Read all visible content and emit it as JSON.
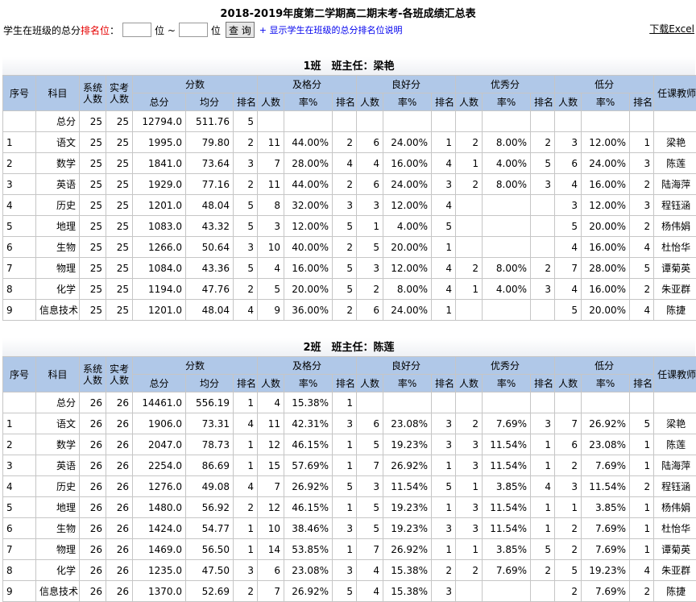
{
  "page_title": "2018-2019年度第二学期高二期末考-各班成绩汇总表",
  "filter": {
    "label_prefix": "学生在班级的总分",
    "label_highlight": "排名位",
    "label_suffix": "：",
    "from_value": "",
    "separator_1": "位 ~",
    "to_value": "",
    "separator_2": "位",
    "query_button": "查 询",
    "help_link": "+ 显示学生在班级的总分排名位说明"
  },
  "download_link": "下载Excel",
  "headers": {
    "seq": "序号",
    "subject": "科目",
    "sys_count_1": "系统",
    "sys_count_2": "人数",
    "act_count_1": "实考",
    "act_count_2": "人数",
    "score": "分数",
    "pass": "及格分",
    "good": "良好分",
    "excellent": "优秀分",
    "low": "低分",
    "teacher": "任课教师",
    "total": "总分",
    "avg": "均分",
    "rank": "排名",
    "count": "人数",
    "rate": "率%"
  },
  "classes": [
    {
      "title": "1班　班主任：梁艳",
      "rows": [
        {
          "seq": "",
          "subject": "总分",
          "sys": "25",
          "act": "25",
          "total": "12794.0",
          "avg": "511.76",
          "rank": "5",
          "pass_n": "",
          "pass_rate": "",
          "pass_rank": "",
          "good_n": "",
          "good_rate": "",
          "good_rank": "",
          "exc_n": "",
          "exc_rate": "",
          "exc_rank": "",
          "low_n": "",
          "low_rate": "",
          "low_rank": "",
          "teacher": ""
        },
        {
          "seq": "1",
          "subject": "语文",
          "sys": "25",
          "act": "25",
          "total": "1995.0",
          "avg": "79.80",
          "rank": "2",
          "pass_n": "11",
          "pass_rate": "44.00%",
          "pass_rank": "2",
          "good_n": "6",
          "good_rate": "24.00%",
          "good_rank": "1",
          "exc_n": "2",
          "exc_rate": "8.00%",
          "exc_rank": "2",
          "low_n": "3",
          "low_rate": "12.00%",
          "low_rank": "1",
          "teacher": "梁艳"
        },
        {
          "seq": "2",
          "subject": "数学",
          "sys": "25",
          "act": "25",
          "total": "1841.0",
          "avg": "73.64",
          "rank": "3",
          "pass_n": "7",
          "pass_rate": "28.00%",
          "pass_rank": "4",
          "good_n": "4",
          "good_rate": "16.00%",
          "good_rank": "4",
          "exc_n": "1",
          "exc_rate": "4.00%",
          "exc_rank": "5",
          "low_n": "6",
          "low_rate": "24.00%",
          "low_rank": "3",
          "teacher": "陈莲"
        },
        {
          "seq": "3",
          "subject": "英语",
          "sys": "25",
          "act": "25",
          "total": "1929.0",
          "avg": "77.16",
          "rank": "2",
          "pass_n": "11",
          "pass_rate": "44.00%",
          "pass_rank": "2",
          "good_n": "6",
          "good_rate": "24.00%",
          "good_rank": "3",
          "exc_n": "2",
          "exc_rate": "8.00%",
          "exc_rank": "3",
          "low_n": "4",
          "low_rate": "16.00%",
          "low_rank": "2",
          "teacher": "陆海萍"
        },
        {
          "seq": "4",
          "subject": "历史",
          "sys": "25",
          "act": "25",
          "total": "1201.0",
          "avg": "48.04",
          "rank": "5",
          "pass_n": "8",
          "pass_rate": "32.00%",
          "pass_rank": "3",
          "good_n": "3",
          "good_rate": "12.00%",
          "good_rank": "4",
          "exc_n": "",
          "exc_rate": "",
          "exc_rank": "",
          "low_n": "3",
          "low_rate": "12.00%",
          "low_rank": "3",
          "teacher": "程钰涵"
        },
        {
          "seq": "5",
          "subject": "地理",
          "sys": "25",
          "act": "25",
          "total": "1083.0",
          "avg": "43.32",
          "rank": "5",
          "pass_n": "3",
          "pass_rate": "12.00%",
          "pass_rank": "5",
          "good_n": "1",
          "good_rate": "4.00%",
          "good_rank": "5",
          "exc_n": "",
          "exc_rate": "",
          "exc_rank": "",
          "low_n": "5",
          "low_rate": "20.00%",
          "low_rank": "2",
          "teacher": "杨伟娟"
        },
        {
          "seq": "6",
          "subject": "生物",
          "sys": "25",
          "act": "25",
          "total": "1266.0",
          "avg": "50.64",
          "rank": "3",
          "pass_n": "10",
          "pass_rate": "40.00%",
          "pass_rank": "2",
          "good_n": "5",
          "good_rate": "20.00%",
          "good_rank": "1",
          "exc_n": "",
          "exc_rate": "",
          "exc_rank": "",
          "low_n": "4",
          "low_rate": "16.00%",
          "low_rank": "4",
          "teacher": "杜怡华"
        },
        {
          "seq": "7",
          "subject": "物理",
          "sys": "25",
          "act": "25",
          "total": "1084.0",
          "avg": "43.36",
          "rank": "5",
          "pass_n": "4",
          "pass_rate": "16.00%",
          "pass_rank": "5",
          "good_n": "3",
          "good_rate": "12.00%",
          "good_rank": "4",
          "exc_n": "2",
          "exc_rate": "8.00%",
          "exc_rank": "2",
          "low_n": "7",
          "low_rate": "28.00%",
          "low_rank": "5",
          "teacher": "谭菊英"
        },
        {
          "seq": "8",
          "subject": "化学",
          "sys": "25",
          "act": "25",
          "total": "1194.0",
          "avg": "47.76",
          "rank": "2",
          "pass_n": "5",
          "pass_rate": "20.00%",
          "pass_rank": "5",
          "good_n": "2",
          "good_rate": "8.00%",
          "good_rank": "4",
          "exc_n": "1",
          "exc_rate": "4.00%",
          "exc_rank": "3",
          "low_n": "4",
          "low_rate": "16.00%",
          "low_rank": "2",
          "teacher": "朱亚群"
        },
        {
          "seq": "9",
          "subject": "信息技术",
          "sys": "25",
          "act": "25",
          "total": "1201.0",
          "avg": "48.04",
          "rank": "4",
          "pass_n": "9",
          "pass_rate": "36.00%",
          "pass_rank": "2",
          "good_n": "6",
          "good_rate": "24.00%",
          "good_rank": "1",
          "exc_n": "",
          "exc_rate": "",
          "exc_rank": "",
          "low_n": "5",
          "low_rate": "20.00%",
          "low_rank": "4",
          "teacher": "陈捷"
        }
      ]
    },
    {
      "title": "2班　班主任：陈莲",
      "rows": [
        {
          "seq": "",
          "subject": "总分",
          "sys": "26",
          "act": "26",
          "total": "14461.0",
          "avg": "556.19",
          "rank": "1",
          "pass_n": "4",
          "pass_rate": "15.38%",
          "pass_rank": "1",
          "good_n": "",
          "good_rate": "",
          "good_rank": "",
          "exc_n": "",
          "exc_rate": "",
          "exc_rank": "",
          "low_n": "",
          "low_rate": "",
          "low_rank": "",
          "teacher": ""
        },
        {
          "seq": "1",
          "subject": "语文",
          "sys": "26",
          "act": "26",
          "total": "1906.0",
          "avg": "73.31",
          "rank": "4",
          "pass_n": "11",
          "pass_rate": "42.31%",
          "pass_rank": "3",
          "good_n": "6",
          "good_rate": "23.08%",
          "good_rank": "3",
          "exc_n": "2",
          "exc_rate": "7.69%",
          "exc_rank": "3",
          "low_n": "7",
          "low_rate": "26.92%",
          "low_rank": "5",
          "teacher": "梁艳"
        },
        {
          "seq": "2",
          "subject": "数学",
          "sys": "26",
          "act": "26",
          "total": "2047.0",
          "avg": "78.73",
          "rank": "1",
          "pass_n": "12",
          "pass_rate": "46.15%",
          "pass_rank": "1",
          "good_n": "5",
          "good_rate": "19.23%",
          "good_rank": "3",
          "exc_n": "3",
          "exc_rate": "11.54%",
          "exc_rank": "1",
          "low_n": "6",
          "low_rate": "23.08%",
          "low_rank": "1",
          "teacher": "陈莲"
        },
        {
          "seq": "3",
          "subject": "英语",
          "sys": "26",
          "act": "26",
          "total": "2254.0",
          "avg": "86.69",
          "rank": "1",
          "pass_n": "15",
          "pass_rate": "57.69%",
          "pass_rank": "1",
          "good_n": "7",
          "good_rate": "26.92%",
          "good_rank": "1",
          "exc_n": "3",
          "exc_rate": "11.54%",
          "exc_rank": "1",
          "low_n": "2",
          "low_rate": "7.69%",
          "low_rank": "1",
          "teacher": "陆海萍"
        },
        {
          "seq": "4",
          "subject": "历史",
          "sys": "26",
          "act": "26",
          "total": "1276.0",
          "avg": "49.08",
          "rank": "4",
          "pass_n": "7",
          "pass_rate": "26.92%",
          "pass_rank": "5",
          "good_n": "3",
          "good_rate": "11.54%",
          "good_rank": "5",
          "exc_n": "1",
          "exc_rate": "3.85%",
          "exc_rank": "4",
          "low_n": "3",
          "low_rate": "11.54%",
          "low_rank": "2",
          "teacher": "程钰涵"
        },
        {
          "seq": "5",
          "subject": "地理",
          "sys": "26",
          "act": "26",
          "total": "1480.0",
          "avg": "56.92",
          "rank": "2",
          "pass_n": "12",
          "pass_rate": "46.15%",
          "pass_rank": "1",
          "good_n": "5",
          "good_rate": "19.23%",
          "good_rank": "1",
          "exc_n": "3",
          "exc_rate": "11.54%",
          "exc_rank": "1",
          "low_n": "1",
          "low_rate": "3.85%",
          "low_rank": "1",
          "teacher": "杨伟娟"
        },
        {
          "seq": "6",
          "subject": "生物",
          "sys": "26",
          "act": "26",
          "total": "1424.0",
          "avg": "54.77",
          "rank": "1",
          "pass_n": "10",
          "pass_rate": "38.46%",
          "pass_rank": "3",
          "good_n": "5",
          "good_rate": "19.23%",
          "good_rank": "3",
          "exc_n": "3",
          "exc_rate": "11.54%",
          "exc_rank": "1",
          "low_n": "2",
          "low_rate": "7.69%",
          "low_rank": "1",
          "teacher": "杜怡华"
        },
        {
          "seq": "7",
          "subject": "物理",
          "sys": "26",
          "act": "26",
          "total": "1469.0",
          "avg": "56.50",
          "rank": "1",
          "pass_n": "14",
          "pass_rate": "53.85%",
          "pass_rank": "1",
          "good_n": "7",
          "good_rate": "26.92%",
          "good_rank": "1",
          "exc_n": "1",
          "exc_rate": "3.85%",
          "exc_rank": "5",
          "low_n": "2",
          "low_rate": "7.69%",
          "low_rank": "1",
          "teacher": "谭菊英"
        },
        {
          "seq": "8",
          "subject": "化学",
          "sys": "26",
          "act": "26",
          "total": "1235.0",
          "avg": "47.50",
          "rank": "3",
          "pass_n": "6",
          "pass_rate": "23.08%",
          "pass_rank": "3",
          "good_n": "4",
          "good_rate": "15.38%",
          "good_rank": "2",
          "exc_n": "2",
          "exc_rate": "7.69%",
          "exc_rank": "2",
          "low_n": "5",
          "low_rate": "19.23%",
          "low_rank": "4",
          "teacher": "朱亚群"
        },
        {
          "seq": "9",
          "subject": "信息技术",
          "sys": "26",
          "act": "26",
          "total": "1370.0",
          "avg": "52.69",
          "rank": "2",
          "pass_n": "7",
          "pass_rate": "26.92%",
          "pass_rank": "5",
          "good_n": "4",
          "good_rate": "15.38%",
          "good_rank": "3",
          "exc_n": "",
          "exc_rate": "",
          "exc_rank": "",
          "low_n": "2",
          "low_rate": "7.69%",
          "low_rank": "2",
          "teacher": "陈捷"
        }
      ]
    }
  ]
}
